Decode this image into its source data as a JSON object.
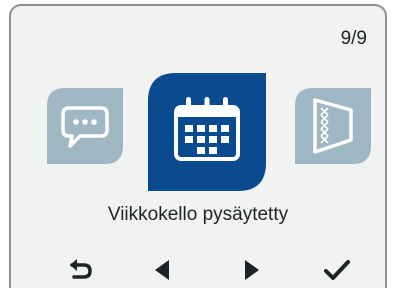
{
  "header": {
    "page_indicator": "9/9"
  },
  "carousel": {
    "items": [
      {
        "icon": "speech-bubble-icon",
        "state": "inactive"
      },
      {
        "icon": "calendar-icon",
        "state": "selected"
      },
      {
        "icon": "filter-icon",
        "state": "inactive"
      }
    ]
  },
  "status": {
    "text": "Viikkokello pysäytetty"
  },
  "navigation": {
    "buttons": [
      {
        "icon": "back-icon"
      },
      {
        "icon": "arrow-left-icon"
      },
      {
        "icon": "arrow-right-icon"
      },
      {
        "icon": "checkmark-icon"
      }
    ]
  },
  "colors": {
    "screen_background": "#f1f2f2",
    "selected_tile": "#0a4a8e",
    "inactive_tile": "#9fb7c3",
    "text": "#1f2328"
  }
}
